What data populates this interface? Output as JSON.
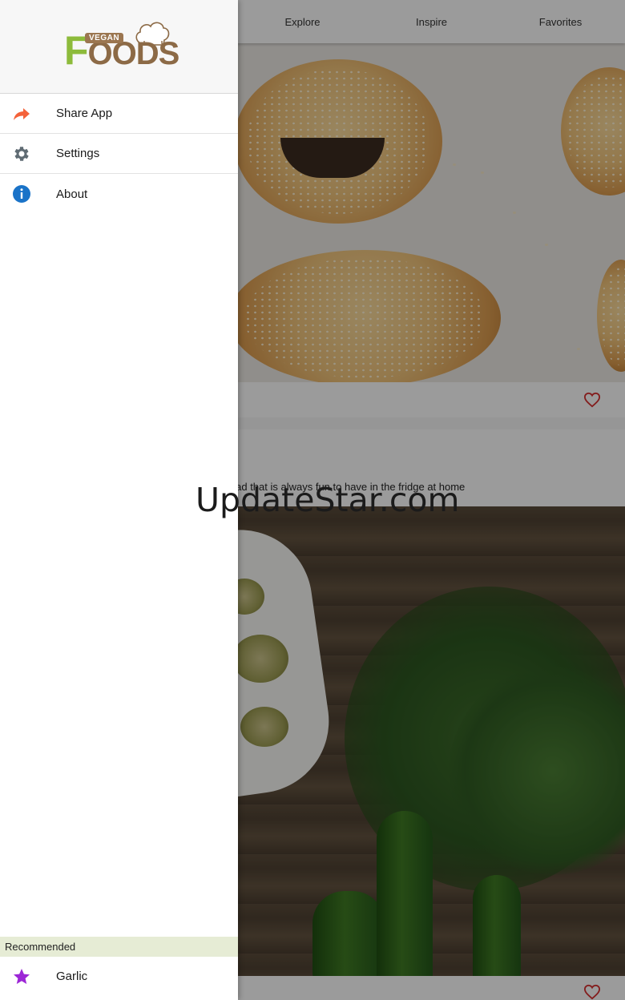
{
  "tabs": [
    "Explore",
    "Inspire",
    "Favorites"
  ],
  "card2": {
    "description": "alad that is always fun to have in the fridge at home"
  },
  "drawer": {
    "logo": {
      "vegan": "VEGAN",
      "foods": "FOODS"
    },
    "items": [
      {
        "label": "Share App",
        "icon": "share-icon"
      },
      {
        "label": "Settings",
        "icon": "gear-icon"
      },
      {
        "label": "About",
        "icon": "info-icon"
      }
    ],
    "recommended_header": "Recommended",
    "recommended_items": [
      {
        "label": "Garlic",
        "icon": "star-icon"
      }
    ]
  },
  "watermark": "UpdateStar.com",
  "colors": {
    "brand_green": "#8dbb3b",
    "brand_brown": "#8c6a46",
    "share_icon": "#f4623a",
    "gear_icon": "#5f6b73",
    "info_icon": "#1a73c8",
    "star_icon": "#9c27d6",
    "heart": "#d32f2f"
  }
}
